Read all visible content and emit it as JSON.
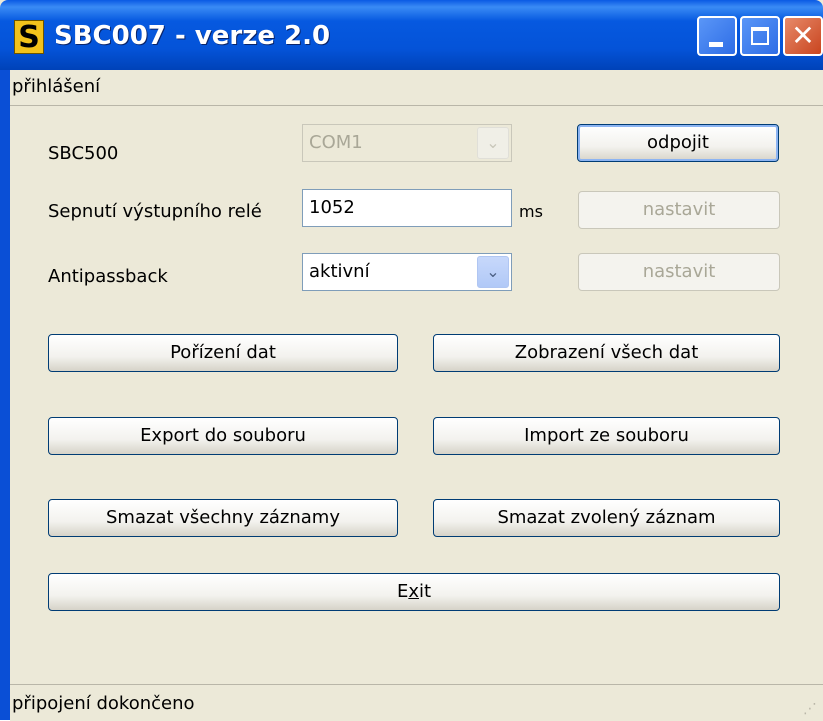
{
  "window": {
    "title": "SBC007 - verze 2.0",
    "icon_letter": "S"
  },
  "menu": {
    "items": [
      {
        "label": "přihlášení"
      }
    ]
  },
  "device": {
    "label": "SBC500",
    "port": "COM1",
    "connect_button": "odpojit"
  },
  "relay": {
    "label": "Sepnutí výstupního relé",
    "value": "1052",
    "unit": "ms",
    "set_button": "nastavit"
  },
  "antipassback": {
    "label": "Antipassback",
    "value": "aktivní",
    "set_button": "nastavit"
  },
  "actions": {
    "acquire": "Pořízení dat",
    "show_all": "Zobrazení všech dat",
    "export": "Export do souboru",
    "import": "Import ze souboru",
    "delete_all": "Smazat všechny záznamy",
    "delete_selected": "Smazat zvolený záznam",
    "exit_prefix": "E",
    "exit_mnemonic": "x",
    "exit_suffix": "it"
  },
  "status": {
    "text": "připojení dokončeno"
  },
  "icons": {
    "combo_arrow": "chevron-down-icon",
    "minimize": "minimize-icon",
    "maximize": "maximize-icon",
    "close": "close-icon",
    "grip": "resize-grip-icon"
  }
}
